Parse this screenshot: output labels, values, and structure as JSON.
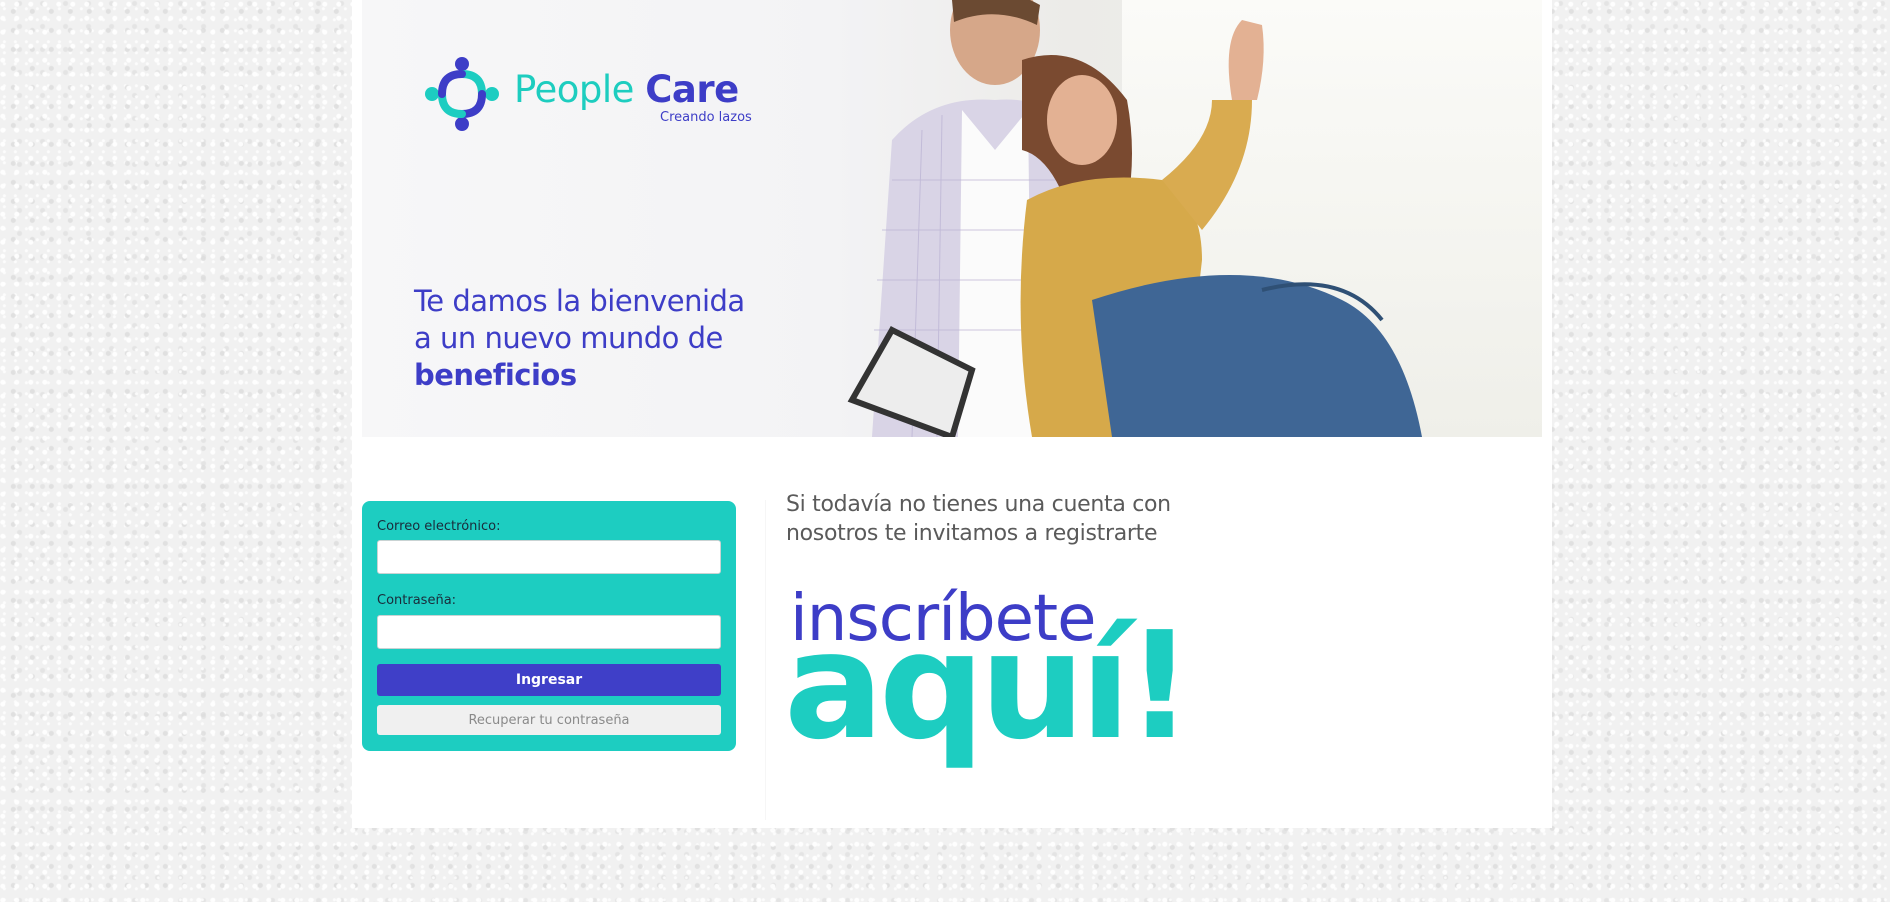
{
  "brand": {
    "name_part1": "People",
    "name_part2": "Care",
    "tagline": "Creando lazos",
    "colors": {
      "teal": "#1dcdc1",
      "indigo": "#3d3dc7"
    }
  },
  "hero": {
    "line1": "Te damos la bienvenida",
    "line2": "a un nuevo mundo de",
    "line3": "beneficios"
  },
  "login": {
    "email_label": "Correo electrónico:",
    "email_value": "",
    "password_label": "Contraseña:",
    "password_value": "",
    "submit_label": "Ingresar",
    "recover_label": "Recuperar tu contraseña"
  },
  "register": {
    "line1": "Si todavía no tienes una cuenta con",
    "line2": "nosotros te invitamos a registrarte",
    "cta_top": "inscríbete",
    "cta_bottom": "aquí!"
  }
}
